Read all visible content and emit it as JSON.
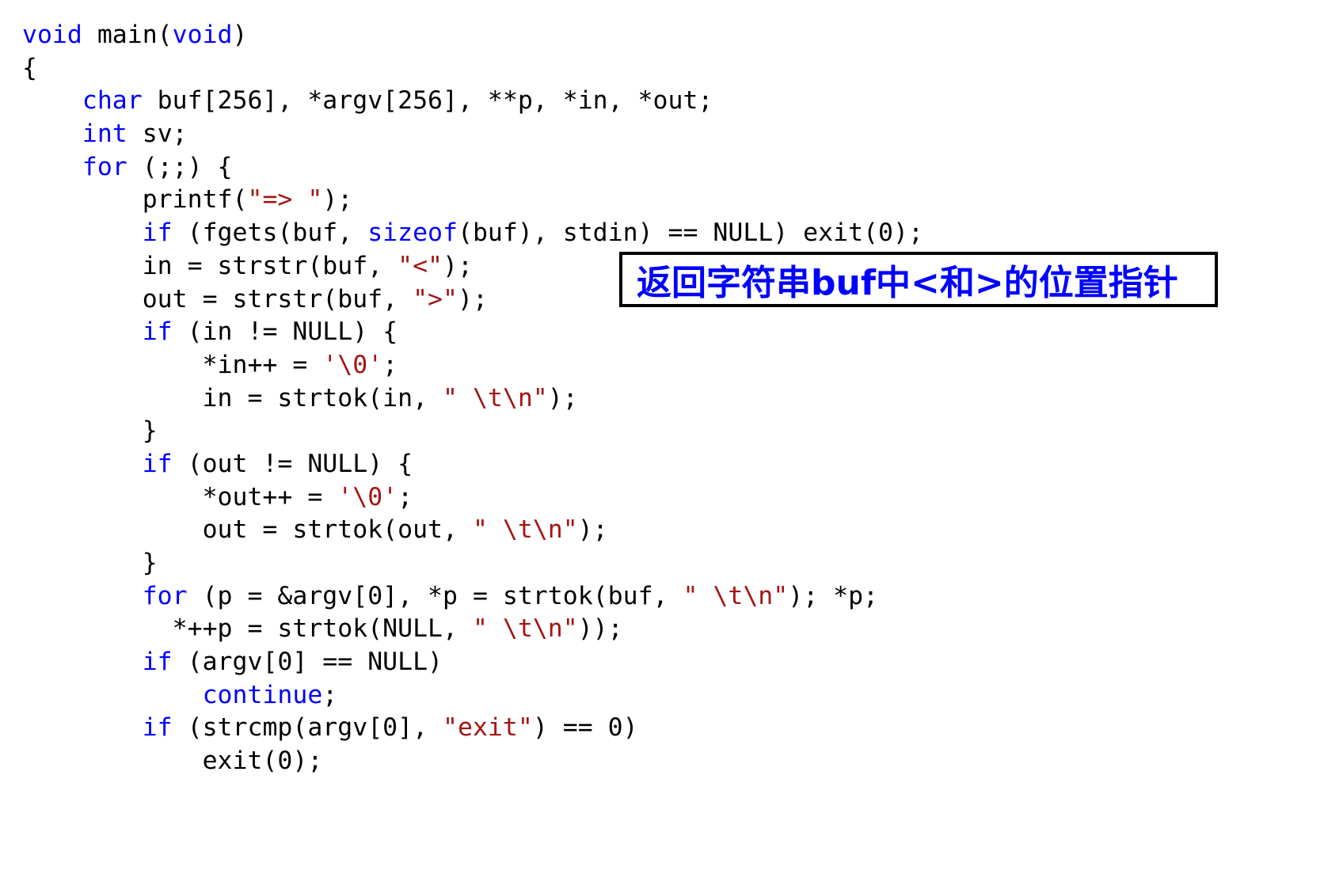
{
  "colors": {
    "keyword": "#0000ff",
    "string": "#a31515",
    "plain": "#000000",
    "callout_text": "#0000ff",
    "callout_border": "#000000"
  },
  "code_lines": [
    [
      {
        "t": "kw",
        "v": "void"
      },
      {
        "t": "plain",
        "v": " main("
      },
      {
        "t": "kw",
        "v": "void"
      },
      {
        "t": "plain",
        "v": ")"
      }
    ],
    [
      {
        "t": "plain",
        "v": "{"
      }
    ],
    [
      {
        "t": "plain",
        "v": "    "
      },
      {
        "t": "kw",
        "v": "char"
      },
      {
        "t": "plain",
        "v": " buf[256], *argv[256], **p, *in, *out;"
      }
    ],
    [
      {
        "t": "plain",
        "v": "    "
      },
      {
        "t": "kw",
        "v": "int"
      },
      {
        "t": "plain",
        "v": " sv;"
      }
    ],
    [
      {
        "t": "plain",
        "v": "    "
      },
      {
        "t": "kw",
        "v": "for"
      },
      {
        "t": "plain",
        "v": " (;;) {"
      }
    ],
    [
      {
        "t": "plain",
        "v": "        printf("
      },
      {
        "t": "str",
        "v": "\"=> \""
      },
      {
        "t": "plain",
        "v": ");"
      }
    ],
    [
      {
        "t": "plain",
        "v": "        "
      },
      {
        "t": "kw",
        "v": "if"
      },
      {
        "t": "plain",
        "v": " (fgets(buf, "
      },
      {
        "t": "kw",
        "v": "sizeof"
      },
      {
        "t": "plain",
        "v": "(buf), stdin) == NULL) exit(0);"
      }
    ],
    [
      {
        "t": "plain",
        "v": "        in = strstr(buf, "
      },
      {
        "t": "str",
        "v": "\"<\""
      },
      {
        "t": "plain",
        "v": ");"
      }
    ],
    [
      {
        "t": "plain",
        "v": "        out = strstr(buf, "
      },
      {
        "t": "str",
        "v": "\">\""
      },
      {
        "t": "plain",
        "v": ");"
      }
    ],
    [
      {
        "t": "plain",
        "v": "        "
      },
      {
        "t": "kw",
        "v": "if"
      },
      {
        "t": "plain",
        "v": " (in != NULL) {"
      }
    ],
    [
      {
        "t": "plain",
        "v": "            *in++ = "
      },
      {
        "t": "str",
        "v": "'\\0'"
      },
      {
        "t": "plain",
        "v": ";"
      }
    ],
    [
      {
        "t": "plain",
        "v": "            in = strtok(in, "
      },
      {
        "t": "str",
        "v": "\" \\t\\n\""
      },
      {
        "t": "plain",
        "v": ");"
      }
    ],
    [
      {
        "t": "plain",
        "v": "        }"
      }
    ],
    [
      {
        "t": "plain",
        "v": "        "
      },
      {
        "t": "kw",
        "v": "if"
      },
      {
        "t": "plain",
        "v": " (out != NULL) {"
      }
    ],
    [
      {
        "t": "plain",
        "v": "            *out++ = "
      },
      {
        "t": "str",
        "v": "'\\0'"
      },
      {
        "t": "plain",
        "v": ";"
      }
    ],
    [
      {
        "t": "plain",
        "v": "            out = strtok(out, "
      },
      {
        "t": "str",
        "v": "\" \\t\\n\""
      },
      {
        "t": "plain",
        "v": ");"
      }
    ],
    [
      {
        "t": "plain",
        "v": "        }"
      }
    ],
    [
      {
        "t": "plain",
        "v": "        "
      },
      {
        "t": "kw",
        "v": "for"
      },
      {
        "t": "plain",
        "v": " (p = &argv[0], *p = strtok(buf, "
      },
      {
        "t": "str",
        "v": "\" \\t\\n\""
      },
      {
        "t": "plain",
        "v": "); *p;"
      }
    ],
    [
      {
        "t": "plain",
        "v": "          *++p = strtok(NULL, "
      },
      {
        "t": "str",
        "v": "\" \\t\\n\""
      },
      {
        "t": "plain",
        "v": "));"
      }
    ],
    [
      {
        "t": "plain",
        "v": "        "
      },
      {
        "t": "kw",
        "v": "if"
      },
      {
        "t": "plain",
        "v": " (argv[0] == NULL)"
      }
    ],
    [
      {
        "t": "plain",
        "v": "            "
      },
      {
        "t": "kw",
        "v": "continue"
      },
      {
        "t": "plain",
        "v": ";"
      }
    ],
    [
      {
        "t": "plain",
        "v": "        "
      },
      {
        "t": "kw",
        "v": "if"
      },
      {
        "t": "plain",
        "v": " (strcmp(argv[0], "
      },
      {
        "t": "str",
        "v": "\"exit\""
      },
      {
        "t": "plain",
        "v": ") == 0)"
      }
    ],
    [
      {
        "t": "plain",
        "v": "            exit(0);"
      }
    ]
  ],
  "callout": {
    "text": "返回字符串buf中<和>的位置指针"
  }
}
